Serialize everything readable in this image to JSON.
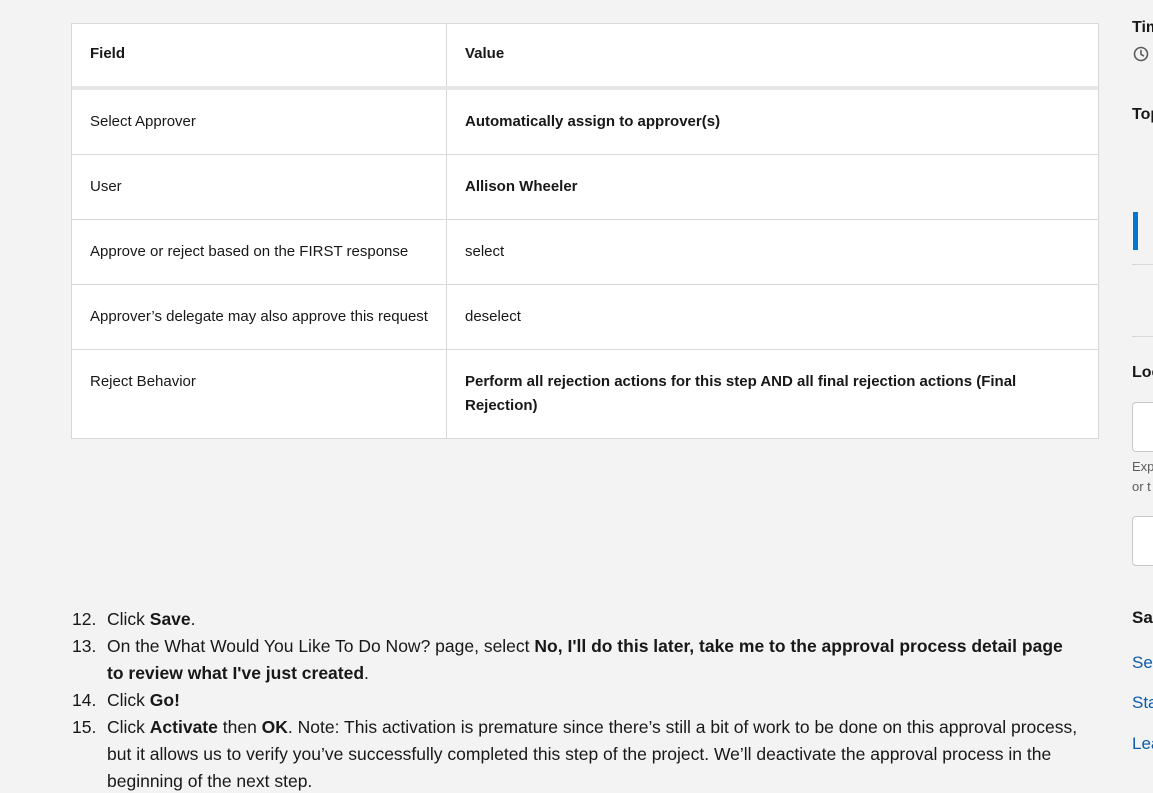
{
  "table": {
    "headers": {
      "field": "Field",
      "value": "Value"
    },
    "rows": [
      {
        "field": "Select Approver",
        "value": "Automatically assign to approver(s)",
        "bold": true
      },
      {
        "field": "User",
        "value": "Allison Wheeler",
        "bold": true
      },
      {
        "field": "Approve or reject based on the FIRST response",
        "value": "select",
        "bold": false
      },
      {
        "field": "Approver’s delegate may also approve this request",
        "value": "deselect",
        "bold": false
      },
      {
        "field": "Reject Behavior",
        "value": "Perform all rejection actions for this step AND all final rejection actions (Final Rejection)",
        "bold": true
      }
    ]
  },
  "steps": [
    {
      "num": "12.",
      "parts": [
        [
          "Click ",
          false
        ],
        [
          "Save",
          true
        ],
        [
          ".",
          false
        ]
      ]
    },
    {
      "num": "13.",
      "parts": [
        [
          "On the What Would You Like To Do Now? page, select ",
          false
        ],
        [
          "No, I'll do this later, take me to the approval process detail page to review what I've just created",
          true
        ],
        [
          ".",
          false
        ]
      ]
    },
    {
      "num": "14.",
      "parts": [
        [
          "Click ",
          false
        ],
        [
          "Go!",
          true
        ]
      ]
    },
    {
      "num": "15.",
      "parts": [
        [
          "Click ",
          false
        ],
        [
          "Activate",
          true
        ],
        [
          " then ",
          false
        ],
        [
          "OK",
          true
        ],
        [
          ". Note: This activation is premature since there’s still a bit of work to be done on this approval process, but it allows us to verify you’ve successfully completed this step of the project. We’ll deactivate the approval process in the beginning of the next step.",
          false
        ]
      ]
    }
  ],
  "sidebar": {
    "time_heading": "Tim",
    "topics_heading": "Top",
    "locale_heading": "Loc",
    "help_text_line1": "Exp",
    "help_text_line2": "or t",
    "save_heading": "Sa",
    "links": [
      "Se",
      "Sta",
      "Lea"
    ]
  },
  "colors": {
    "link": "#0b5cab",
    "accent_bar": "#0176d3",
    "background": "#f3f3f3"
  },
  "icons": {
    "clock": "clock-icon"
  }
}
